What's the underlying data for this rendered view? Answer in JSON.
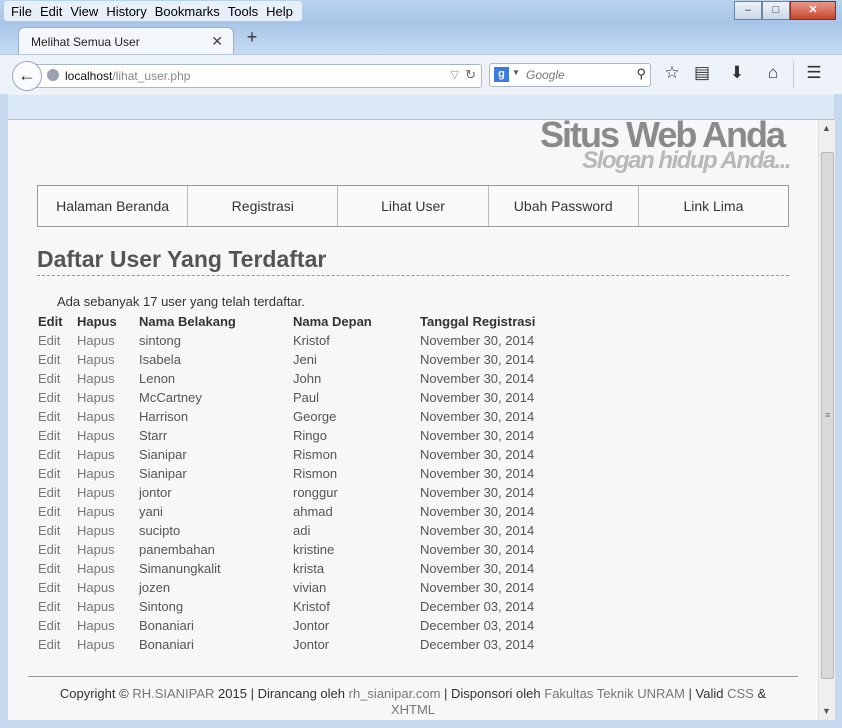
{
  "browser": {
    "menu": [
      "File",
      "Edit",
      "View",
      "History",
      "Bookmarks",
      "Tools",
      "Help"
    ],
    "tab_title": "Melihat Semua User",
    "url_host": "localhost",
    "url_path": "/lihat_user.php",
    "search_placeholder": "Google",
    "icons": {
      "back": "back-arrow-icon",
      "reload": "reload-icon",
      "search": "magnifier-icon",
      "bookmark_star": "star-icon",
      "reading_list": "clipboard-icon",
      "download": "download-arrow-icon",
      "home": "home-icon",
      "menu": "hamburger-menu-icon"
    }
  },
  "site": {
    "title": "Situs Web Anda",
    "slogan": "Slogan hidup Anda..."
  },
  "nav": [
    "Halaman Beranda",
    "Registrasi",
    "Lihat User",
    "Ubah Password",
    "Link Lima"
  ],
  "page": {
    "heading": "Daftar User Yang Terdaftar",
    "count_text": "Ada sebanyak 17 user yang telah terdaftar."
  },
  "table": {
    "headers": [
      "Edit",
      "Hapus",
      "Nama Belakang",
      "Nama Depan",
      "Tanggal Registrasi"
    ],
    "rows": [
      [
        "Edit",
        "Hapus",
        "sintong",
        "Kristof",
        "November 30, 2014"
      ],
      [
        "Edit",
        "Hapus",
        "Isabela",
        "Jeni",
        "November 30, 2014"
      ],
      [
        "Edit",
        "Hapus",
        "Lenon",
        "John",
        "November 30, 2014"
      ],
      [
        "Edit",
        "Hapus",
        "McCartney",
        "Paul",
        "November 30, 2014"
      ],
      [
        "Edit",
        "Hapus",
        "Harrison",
        "George",
        "November 30, 2014"
      ],
      [
        "Edit",
        "Hapus",
        "Starr",
        "Ringo",
        "November 30, 2014"
      ],
      [
        "Edit",
        "Hapus",
        "Sianipar",
        "Rismon",
        "November 30, 2014"
      ],
      [
        "Edit",
        "Hapus",
        "Sianipar",
        "Rismon",
        "November 30, 2014"
      ],
      [
        "Edit",
        "Hapus",
        "jontor",
        "ronggur",
        "November 30, 2014"
      ],
      [
        "Edit",
        "Hapus",
        "yani",
        "ahmad",
        "November 30, 2014"
      ],
      [
        "Edit",
        "Hapus",
        "sucipto",
        "adi",
        "November 30, 2014"
      ],
      [
        "Edit",
        "Hapus",
        "panembahan",
        "kristine",
        "November 30, 2014"
      ],
      [
        "Edit",
        "Hapus",
        "Simanungkalit",
        "krista",
        "November 30, 2014"
      ],
      [
        "Edit",
        "Hapus",
        "jozen",
        "vivian",
        "November 30, 2014"
      ],
      [
        "Edit",
        "Hapus",
        "Sintong",
        "Kristof",
        "December 03, 2014"
      ],
      [
        "Edit",
        "Hapus",
        "Bonaniari",
        "Jontor",
        "December 03, 2014"
      ],
      [
        "Edit",
        "Hapus",
        "Bonaniari",
        "Jontor",
        "December 03, 2014"
      ]
    ]
  },
  "footer": {
    "copyright_prefix": "Copyright ©",
    "owner": "RH.SIANIPAR",
    "year_designed": "2015 | Dirancang oleh",
    "designer": "rh_sianipar.com",
    "sponsored": "| Disponsori oleh",
    "sponsor": "Fakultas Teknik UNRAM",
    "valid": "| Valid",
    "css": "CSS",
    "amp": "&",
    "xhtml": "XHTML"
  }
}
